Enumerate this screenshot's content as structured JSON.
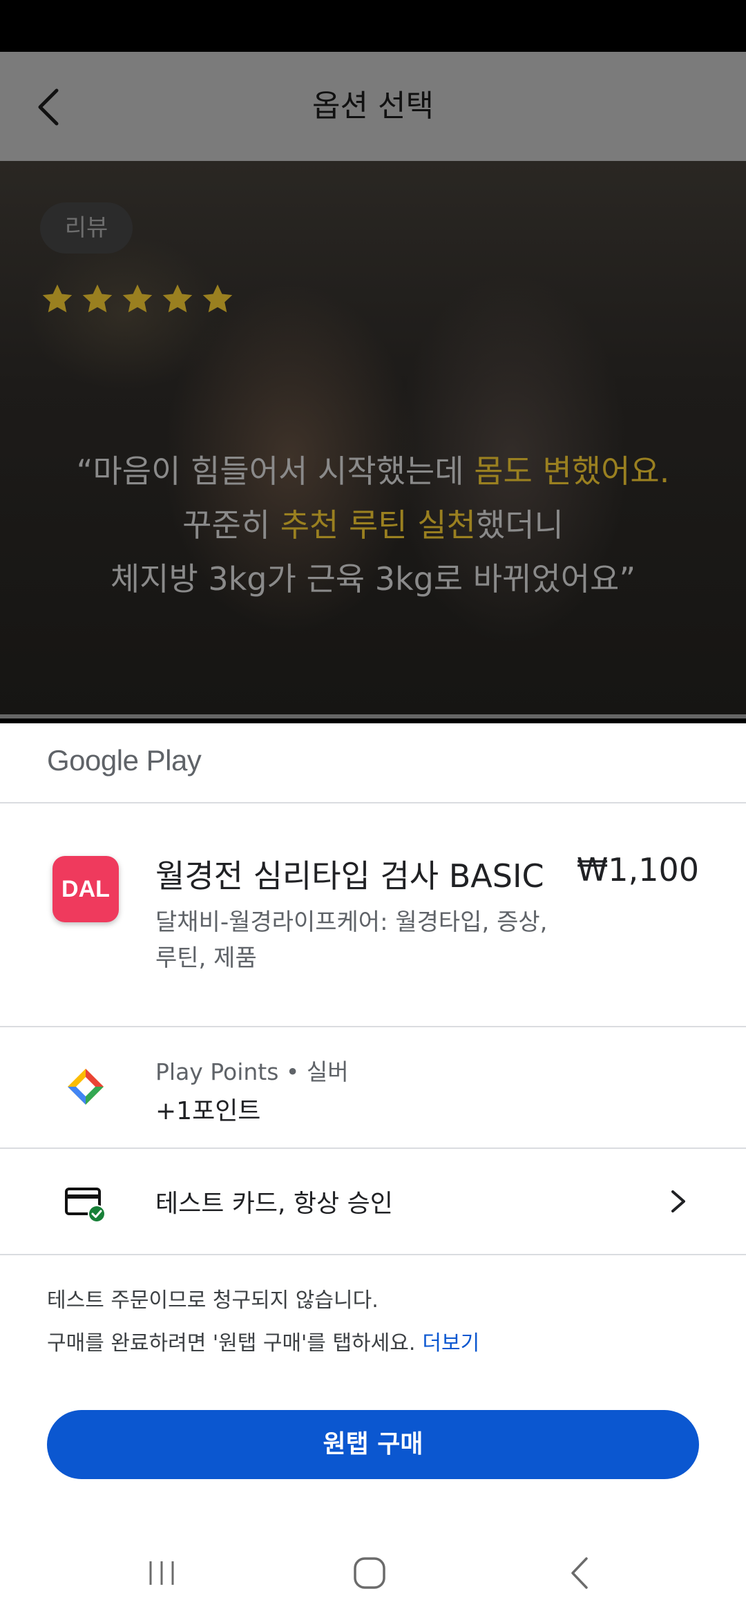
{
  "header": {
    "title": "옵션 선택"
  },
  "hero": {
    "badge": "리뷰",
    "rating": 5,
    "star_color": "#9a8020",
    "quote": {
      "line1_a": "“마음이 힘들어서 시작했는데 ",
      "line1_b": "몸도 변했어요.",
      "line2_a": "꾸준히 ",
      "line2_b": "추천 루틴 실천",
      "line2_c": "했더니",
      "line3": "체지방 3kg가 근육 3kg로 바뀌었어요”"
    }
  },
  "sheet": {
    "logo": "Google Play",
    "product": {
      "icon_text": "DAL",
      "title": "월경전 심리타입 검사 BASIC",
      "price": "₩1,100",
      "subtitle": "달채비-월경라이프케어: 월경타입, 증상, 루틴, 제품"
    },
    "points": {
      "label": "Play Points • 실버",
      "value": "+1포인트"
    },
    "payment": {
      "label": "테스트 카드, 항상 승인"
    },
    "notes": {
      "line1": "테스트 주문이므로 청구되지 않습니다.",
      "line2": "구매를 완료하려면 '원탭 구매'를 탭하세요.",
      "more": "더보기"
    },
    "buy_button": "원탭 구매"
  },
  "colors": {
    "accent": "#0b57d0",
    "product_icon": "#ef3a5d",
    "highlight": "#9a8020"
  }
}
